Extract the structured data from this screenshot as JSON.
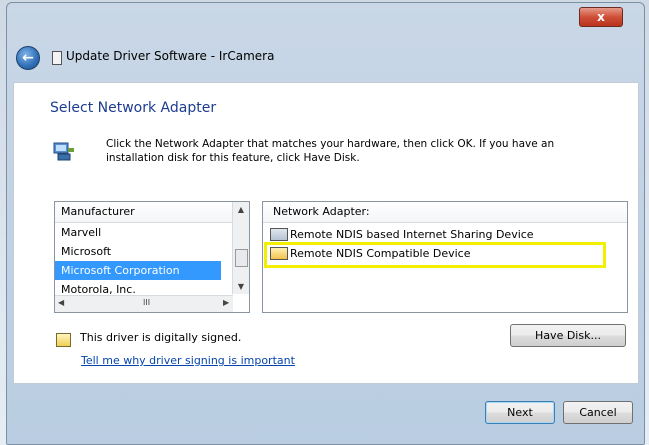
{
  "window": {
    "title": "Update Driver Software - IrCamera",
    "close_glyph": "x",
    "back_icon": "back-arrow-icon"
  },
  "dialog": {
    "heading": "Select Network Adapter",
    "instruction": "Click the Network Adapter that matches your hardware, then click OK. If you have an installation disk for this feature, click Have Disk.",
    "manufacturer": {
      "header": "Manufacturer",
      "items": [
        "Marvell",
        "Microsoft",
        "Microsoft Corporation",
        "Motorola, Inc."
      ],
      "selected": "Microsoft Corporation",
      "hscroll_mark": "III"
    },
    "adapter": {
      "header": "Network Adapter:",
      "items": [
        "Remote NDIS based Internet Sharing Device",
        "Remote NDIS Compatible Device"
      ],
      "highlighted": "Remote NDIS Compatible Device"
    },
    "signing": {
      "text": "This driver is digitally signed.",
      "link": "Tell me why driver signing is important"
    },
    "buttons": {
      "have_disk": "Have Disk...",
      "next": "Next",
      "cancel": "Cancel"
    }
  },
  "colors": {
    "heading": "#1e3d8f",
    "selection": "#3399ff",
    "highlight_box": "#f2f000",
    "link": "#0645ad"
  }
}
